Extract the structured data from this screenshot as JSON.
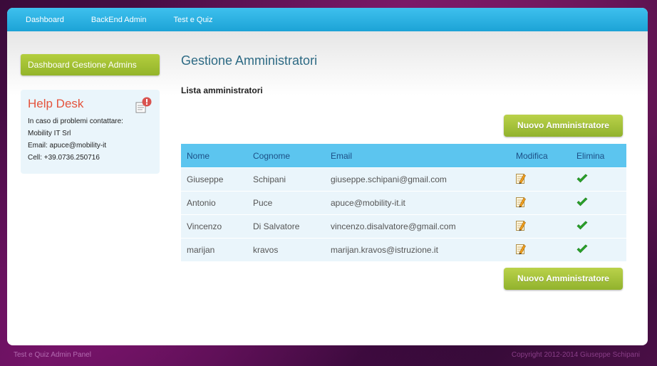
{
  "nav": {
    "items": [
      "Dashboard",
      "BackEnd Admin",
      "Test e Quiz"
    ]
  },
  "sidebar": {
    "button_label": "Dashboard Gestione Admins",
    "helpdesk": {
      "title": "Help Desk",
      "lines": [
        "In caso di problemi contattare:",
        "Mobility IT Srl",
        "Email: apuce@mobility-it",
        "Cell: +39.0736.250716"
      ],
      "icon": "helpdesk-alert-icon"
    }
  },
  "main": {
    "title": "Gestione Amministratori",
    "subtitle": "Lista amministratori",
    "new_button_label": "Nuovo Amministratore",
    "table": {
      "headers": [
        "Nome",
        "Cognome",
        "Email",
        "Modifica",
        "Elimina"
      ],
      "rows": [
        {
          "nome": "Giuseppe",
          "cognome": "Schipani",
          "email": "giuseppe.schipani@gmail.com"
        },
        {
          "nome": "Antonio",
          "cognome": "Puce",
          "email": "apuce@mobility-it.it"
        },
        {
          "nome": "Vincenzo",
          "cognome": "Di Salvatore",
          "email": "vincenzo.disalvatore@gmail.com"
        },
        {
          "nome": "marijan",
          "cognome": "kravos",
          "email": "marijan.kravos@istruzione.it"
        }
      ],
      "edit_icon": "edit-pencil-icon",
      "delete_icon": "checkmark-icon"
    }
  },
  "footer": {
    "left": "Test e Quiz Admin Panel",
    "right": "Copyright 2012-2014 Giuseppe Schipani"
  },
  "colors": {
    "nav_blue": "#1ca3d6",
    "button_green": "#a3c235",
    "helpdesk_title": "#e4533c",
    "header_row": "#5cc5ef",
    "row_bg": "#eaf5fb"
  }
}
